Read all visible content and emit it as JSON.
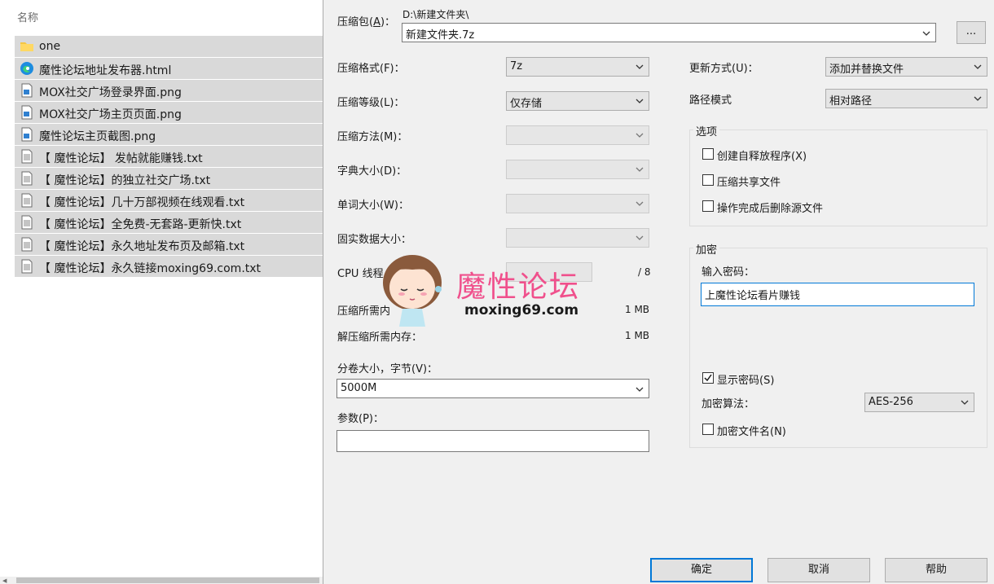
{
  "explorer": {
    "column_header": "名称",
    "files": [
      {
        "name": "one",
        "type": "folder"
      },
      {
        "name": "魔性论坛地址发布器.html",
        "type": "edge-html"
      },
      {
        "name": "MOX社交广场登录界面.png",
        "type": "png"
      },
      {
        "name": "MOX社交广场主页页面.png",
        "type": "png"
      },
      {
        "name": "魔性论坛主页截图.png",
        "type": "png"
      },
      {
        "name": "【 魔性论坛】 发帖就能赚钱.txt",
        "type": "txt"
      },
      {
        "name": "【 魔性论坛】的独立社交广场.txt",
        "type": "txt"
      },
      {
        "name": "【 魔性论坛】几十万部视频在线观看.txt",
        "type": "txt"
      },
      {
        "name": "【 魔性论坛】全免费-无套路-更新快.txt",
        "type": "txt"
      },
      {
        "name": "【 魔性论坛】永久地址发布页及邮箱.txt",
        "type": "txt"
      },
      {
        "name": "【 魔性论坛】永久链接moxing69.com.txt",
        "type": "txt"
      }
    ]
  },
  "dialog": {
    "archive_label": "压缩包(A)：",
    "archive_label_main": "压缩包(",
    "archive_label_key": "A",
    "archive_label_tail": ")：",
    "archive_path": "D:\\新建文件夹\\",
    "archive_name": "新建文件夹.7z",
    "browse_label": "...",
    "left": {
      "format_label": "压缩格式(F)：",
      "format_value": "7z",
      "level_label": "压缩等级(L)：",
      "level_value": "仅存储",
      "method_label": "压缩方法(M)：",
      "dict_label": "字典大小(D)：",
      "word_label": "单词大小(W)：",
      "solid_label": "固实数据大小：",
      "cpu_label": "CPU 线程",
      "cpu_total": "/ 8",
      "mem_comp_label": "压缩所需内",
      "mem_comp_value": "1 MB",
      "mem_decomp_label": "解压缩所需内存：",
      "mem_decomp_value": "1 MB",
      "volume_label": "分卷大小，字节(V)：",
      "volume_value": "5000M",
      "params_label": "参数(P)：",
      "params_value": ""
    },
    "right": {
      "update_label": "更新方式(U)：",
      "update_value": "添加并替换文件",
      "path_label": "路径模式",
      "path_value": "相对路径",
      "options_title": "选项",
      "opt_sfx": "创建自释放程序(X)",
      "opt_shared": "压缩共享文件",
      "opt_delete": "操作完成后删除源文件",
      "encrypt_title": "加密",
      "password_label": "输入密码：",
      "password_value": "上魔性论坛看片赚钱",
      "show_password": "显示密码(S)",
      "method_label": "加密算法：",
      "method_value": "AES-256",
      "encrypt_names": "加密文件名(N)"
    },
    "buttons": {
      "ok": "确定",
      "cancel": "取消",
      "help": "帮助"
    }
  },
  "watermark": {
    "title": "魔性论坛",
    "url": "moxing69.com"
  },
  "colors": {
    "selection": "#d9d9d9",
    "dialog_bg": "#f0f0f0",
    "accent": "#0078d7",
    "watermark_pink": "#f0508c"
  }
}
